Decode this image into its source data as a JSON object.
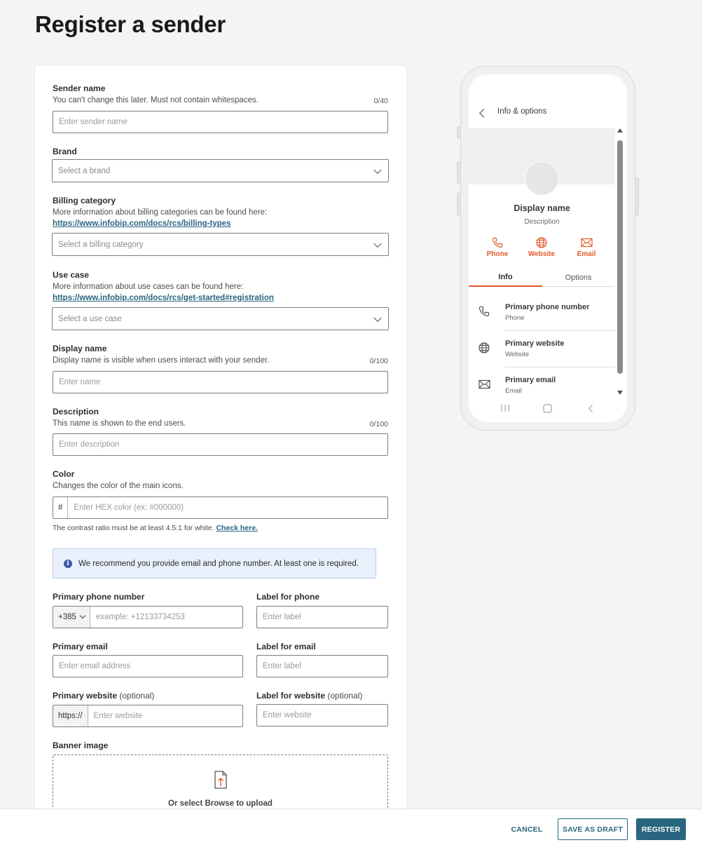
{
  "page": {
    "title": "Register a sender"
  },
  "form": {
    "sender_name": {
      "label": "Sender name",
      "help": "You can't change this later. Must not contain whitespaces.",
      "counter": "0/40",
      "placeholder": "Enter sender name"
    },
    "brand": {
      "label": "Brand",
      "placeholder": "Select a brand"
    },
    "billing": {
      "label": "Billing category",
      "help": "More information about billing categories can be found here:",
      "link": "https://www.infobip.com/docs/rcs/billing-types",
      "placeholder": "Select a billing category"
    },
    "use_case": {
      "label": "Use case",
      "help": "More information about use cases can be found here:",
      "link": "https://www.infobip.com/docs/rcs/get-started#registration",
      "placeholder": "Select a use case"
    },
    "display_name": {
      "label": "Display name",
      "help": "Display name is visible when users interact with your sender.",
      "counter": "0/100",
      "placeholder": "Enter name"
    },
    "description": {
      "label": "Description",
      "help": "This name is shown to the end users.",
      "counter": "0/100",
      "placeholder": "Enter description"
    },
    "color": {
      "label": "Color",
      "help": "Changes the color of the main icons.",
      "prefix": "#",
      "placeholder": "Enter HEX color (ex: #000000)",
      "note": "The contrast ratio must be at least 4.5:1 for white.",
      "note_link": "Check here."
    },
    "info_banner": "We recommend you provide email and phone number. At least one is required.",
    "phone": {
      "label": "Primary phone number",
      "country_code": "+385",
      "placeholder": "example: +12133734253"
    },
    "phone_label": {
      "label": "Label for phone",
      "placeholder": "Enter label"
    },
    "email": {
      "label": "Primary email",
      "placeholder": "Enter email address"
    },
    "email_label": {
      "label": "Label for email",
      "placeholder": "Enter label"
    },
    "website": {
      "label": "Primary website",
      "optional": "(optional)",
      "prefix": "https://",
      "placeholder": "Enter website"
    },
    "website_label": {
      "label": "Label for website",
      "optional": "(optional)",
      "placeholder": "Enter website"
    },
    "banner": {
      "label": "Banner image",
      "upload_text": "Or select Browse to upload"
    }
  },
  "preview": {
    "header_title": "Info & options",
    "display_name": "Display name",
    "description": "Description",
    "actions": [
      {
        "label": "Phone",
        "icon": "phone-icon"
      },
      {
        "label": "Website",
        "icon": "globe-icon"
      },
      {
        "label": "Email",
        "icon": "envelope-icon"
      }
    ],
    "tabs": [
      "Info",
      "Options"
    ],
    "rows": [
      {
        "title": "Primary phone number",
        "subtitle": "Phone",
        "icon": "phone-icon"
      },
      {
        "title": "Primary website",
        "subtitle": "Website",
        "icon": "globe-icon"
      },
      {
        "title": "Primary email",
        "subtitle": "Email",
        "icon": "envelope-icon"
      }
    ],
    "accent_color": "#e35a2a"
  },
  "footer": {
    "cancel": "CANCEL",
    "save_draft": "SAVE AS DRAFT",
    "register": "REGISTER"
  },
  "colors": {
    "primary": "#2a6680",
    "accent": "#e35a2a",
    "info_bg": "#e8f0fb"
  }
}
